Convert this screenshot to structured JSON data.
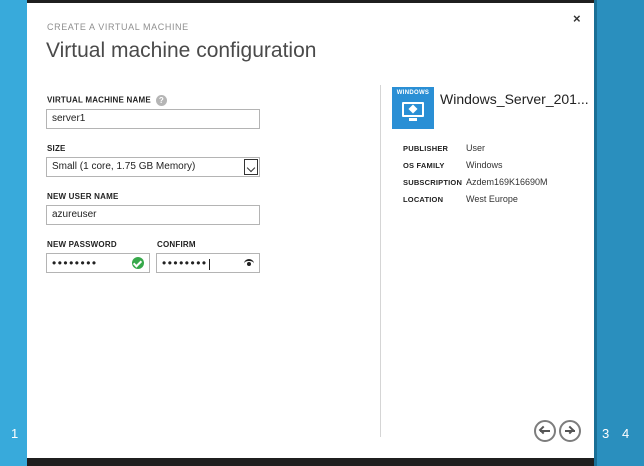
{
  "wizard": {
    "kicker": "CREATE A VIRTUAL MACHINE",
    "title": "Virtual machine configuration",
    "close_label": "×",
    "steps": [
      "1",
      "3",
      "4"
    ]
  },
  "form": {
    "vm_name_label": "VIRTUAL MACHINE NAME",
    "vm_name_value": "server1",
    "size_label": "SIZE",
    "size_value": "Small (1 core, 1.75 GB Memory)",
    "user_label": "NEW USER NAME",
    "user_value": "azureuser",
    "password_label": "NEW PASSWORD",
    "password_value": "••••••••",
    "confirm_label": "CONFIRM",
    "confirm_value": "••••••••"
  },
  "image": {
    "tile_label": "WINDOWS",
    "name": "Windows_Server_201...",
    "properties": [
      {
        "label": "PUBLISHER",
        "value": "User"
      },
      {
        "label": "OS FAMILY",
        "value": "Windows"
      },
      {
        "label": "SUBSCRIPTION",
        "value": "Azdem169K16690M"
      },
      {
        "label": "LOCATION",
        "value": "West Europe"
      }
    ]
  },
  "icons": {
    "help": "help-icon",
    "select": "chevron-down-icon",
    "valid": "check-circle-icon",
    "reveal": "eye-icon",
    "prev": "arrow-left-icon",
    "next": "arrow-right-icon"
  },
  "colors": {
    "accent": "#38aadb",
    "accent_dark": "#2a8fbe",
    "tile": "#2a8fd5",
    "valid": "#37a94b"
  }
}
